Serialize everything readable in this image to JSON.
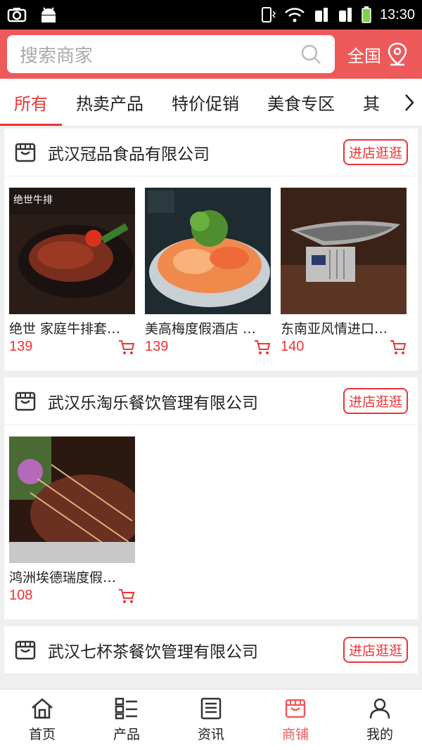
{
  "status": {
    "time": "13:30"
  },
  "search": {
    "placeholder": "搜索商家",
    "region": "全国"
  },
  "tabs": [
    "所有",
    "热卖产品",
    "特价促销",
    "美食专区",
    "其"
  ],
  "stores": [
    {
      "name": "武汉冠品食品有限公司",
      "visit_label": "进店逛逛",
      "products": [
        {
          "name": "绝世 家庭牛排套…",
          "price": "139",
          "image": "steak-image",
          "overlay": "绝世牛排"
        },
        {
          "name": "美高梅度假酒店 …",
          "price": "139",
          "image": "seafood-image",
          "overlay": ""
        },
        {
          "name": "东南亚风情进口…",
          "price": "140",
          "image": "grill-pan-image",
          "overlay": ""
        }
      ]
    },
    {
      "name": "武汉乐淘乐餐饮管理有限公司",
      "visit_label": "进店逛逛",
      "products": [
        {
          "name": "鸿洲埃德瑞度假…",
          "price": "108",
          "image": "skewers-image",
          "overlay": ""
        }
      ]
    },
    {
      "name": "武汉七杯茶餐饮管理有限公司",
      "visit_label": "进店逛逛",
      "products": []
    }
  ],
  "nav": [
    {
      "label": "首页",
      "icon": "home-icon"
    },
    {
      "label": "产品",
      "icon": "products-icon"
    },
    {
      "label": "资讯",
      "icon": "news-icon"
    },
    {
      "label": "商铺",
      "icon": "store-icon"
    },
    {
      "label": "我的",
      "icon": "profile-icon"
    }
  ],
  "colors": {
    "accent": "#ee5a5a",
    "price": "#e33333"
  }
}
